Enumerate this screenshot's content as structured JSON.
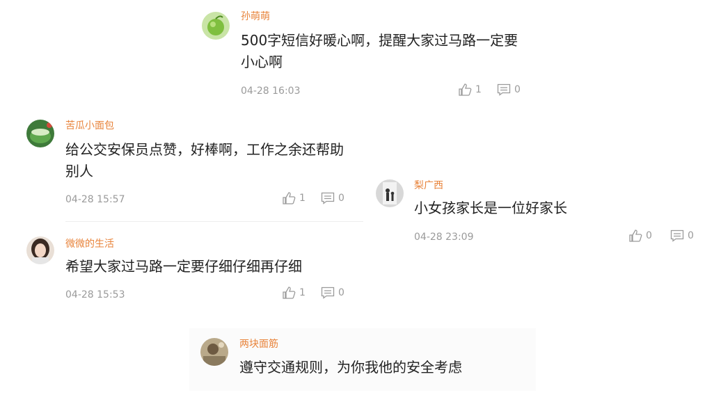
{
  "comments": [
    {
      "username": "孙萌萌",
      "content": "500字短信好暖心啊，提醒大家过马路一定要小心啊",
      "time": "04-28 16:03",
      "likes": "1",
      "replies": "0",
      "avatar_icon": "avatar-green-ball-icon"
    },
    {
      "username": "苦瓜小面包",
      "content": "给公交安保员点赞，好棒啊，工作之余还帮助别人",
      "time": "04-28 15:57",
      "likes": "1",
      "replies": "0",
      "avatar_icon": "avatar-green-bowl-icon"
    },
    {
      "username": "梨广西",
      "content": "小女孩家长是一位好家长",
      "time": "04-28 23:09",
      "likes": "0",
      "replies": "0",
      "avatar_icon": "avatar-silhouette-icon"
    },
    {
      "username": "微微的生活",
      "content": "希望大家过马路一定要仔细仔细再仔细",
      "time": "04-28 15:53",
      "likes": "1",
      "replies": "0",
      "avatar_icon": "avatar-girl-icon"
    },
    {
      "username": "两块面筋",
      "content": "遵守交通规则，为你我他的安全考虑",
      "avatar_icon": "avatar-photo-icon"
    }
  ],
  "colors": {
    "username": "#e8833a",
    "content": "#222222",
    "meta": "#9a9a9a"
  }
}
